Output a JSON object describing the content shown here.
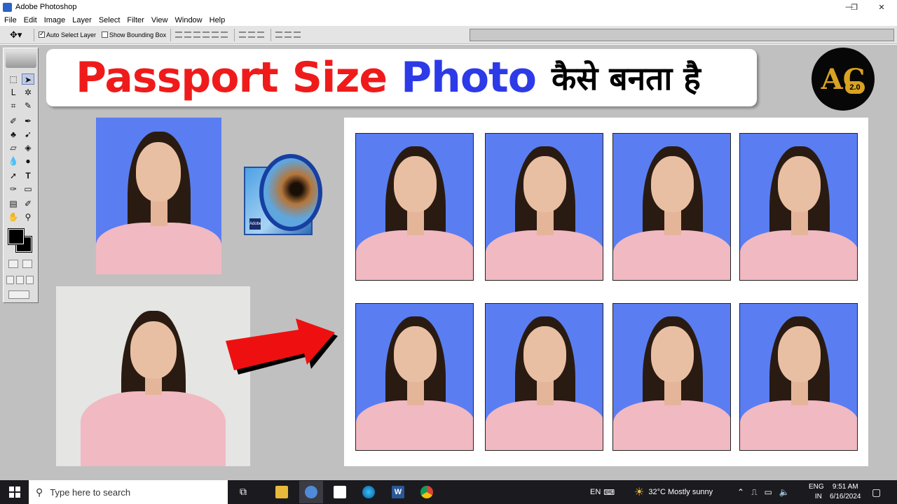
{
  "window": {
    "title": "Adobe Photoshop",
    "minimize": "—",
    "maximize": "❐",
    "close": "✕"
  },
  "menu": [
    "File",
    "Edit",
    "Image",
    "Layer",
    "Select",
    "Filter",
    "View",
    "Window",
    "Help"
  ],
  "options_bar": {
    "auto_select_label": "Auto Select Layer",
    "auto_select_checked": true,
    "bounding_box_label": "Show Bounding Box",
    "bounding_box_checked": false
  },
  "banner": {
    "word1": "Passport",
    "word2": "Size",
    "word3": "Photo",
    "hindi": "कैसे बनता है"
  },
  "logo": {
    "letters": "AC",
    "version": "2.0"
  },
  "photo_sheet": {
    "rows": 2,
    "cols": 4
  },
  "taskbar": {
    "search_placeholder": "Type here to search",
    "language": "EN",
    "weather": "32°C  Mostly sunny",
    "ime_top": "ENG",
    "ime_bottom": "IN",
    "time": "9:51 AM",
    "date": "6/16/2024"
  },
  "colors": {
    "photo_bg": "#5a7ef2",
    "workspace": "#c0c0c0",
    "red_title": "#ef1b1b",
    "blue_title": "#2d3ae8",
    "gold": "#d9a321"
  },
  "icons": [
    "move-tool-icon",
    "marquee-icon",
    "lasso-icon",
    "magic-wand-icon",
    "crop-icon",
    "brush-icon",
    "eraser-icon",
    "text-tool-icon",
    "hand-icon",
    "zoom-icon",
    "windows-start-icon",
    "search-icon",
    "task-view-icon",
    "file-explorer-icon",
    "photoshop-icon",
    "mail-icon",
    "edge-icon",
    "word-icon",
    "chrome-icon",
    "weather-icon",
    "notification-icon"
  ]
}
